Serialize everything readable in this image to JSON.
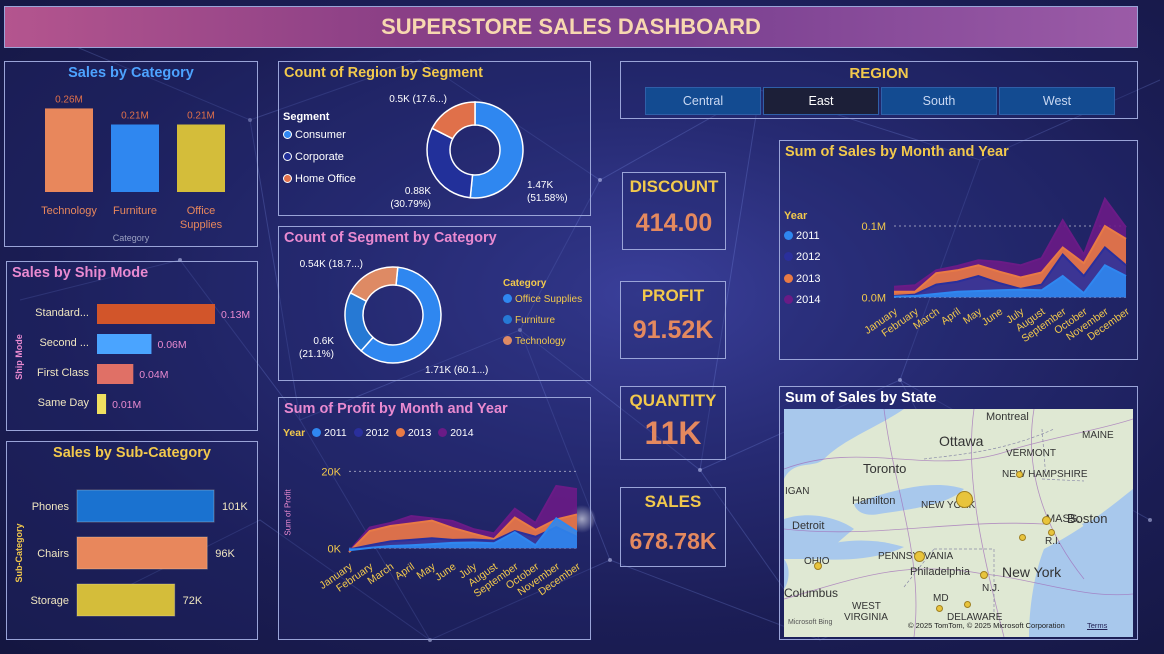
{
  "header": {
    "title": "SUPERSTORE SALES DASHBOARD"
  },
  "colors": {
    "y2011": "#2f87f0",
    "y2012": "#2a2f9c",
    "y2013": "#e87a45",
    "y2014": "#6a1b86",
    "consumer": "#2f87f0",
    "corporate": "#22309a",
    "home_office": "#e0704a",
    "office_supplies": "#2f87f0",
    "furniture": "#2679d4",
    "technology": "#de8a64"
  },
  "sales_by_category": {
    "title": "Sales by Category",
    "axis_title": "Category",
    "chart_data": {
      "type": "bar",
      "categories": [
        "Technology",
        "Furniture",
        "Office Supplies"
      ],
      "values": [
        0.26,
        0.21,
        0.21
      ],
      "labels": [
        "0.26M",
        "0.21M",
        "0.21M"
      ],
      "colors": [
        "#e8875c",
        "#2f87f0",
        "#d4bd3a"
      ],
      "ylim": [
        0,
        0.28
      ]
    }
  },
  "region_by_segment": {
    "title": "Count of Region by Segment",
    "legend_title": "Segment",
    "legend": [
      "Consumer",
      "Corporate",
      "Home Office"
    ],
    "chart_data": {
      "type": "pie",
      "labels": [
        "Consumer",
        "Corporate",
        "Home Office"
      ],
      "values": [
        1.47,
        0.88,
        0.5
      ],
      "slice_labels": [
        "1.47K\n(51.58%)",
        "0.88K\n(30.79%)",
        "0.5K (17.6...)"
      ]
    }
  },
  "segment_by_category": {
    "title": "Count of Segment by Category",
    "legend_title": "Category",
    "legend": [
      "Office Supplies",
      "Furniture",
      "Technology"
    ],
    "chart_data": {
      "type": "pie",
      "labels": [
        "Office Supplies",
        "Furniture",
        "Technology"
      ],
      "values": [
        1.71,
        0.6,
        0.54
      ],
      "slice_labels": [
        "1.71K (60.1...)",
        "0.6K\n(21.1%)",
        "0.54K (18.7...)"
      ]
    }
  },
  "ship_mode": {
    "title": "Sales by Ship Mode",
    "axis_title": "Ship Mode",
    "chart_data": {
      "type": "bar",
      "orientation": "horizontal",
      "categories": [
        "Standard...",
        "Second ...",
        "First Class",
        "Same Day"
      ],
      "values": [
        0.13,
        0.06,
        0.04,
        0.01
      ],
      "labels": [
        "0.13M",
        "0.06M",
        "0.04M",
        "0.01M"
      ],
      "colors": [
        "#d2552a",
        "#4aa4ff",
        "#e07066",
        "#f0e060"
      ],
      "xlim": [
        0,
        0.13
      ]
    }
  },
  "sub_category": {
    "title": "Sales by Sub-Category",
    "axis_title": "Sub-Category",
    "chart_data": {
      "type": "bar",
      "orientation": "horizontal",
      "categories": [
        "Phones",
        "Chairs",
        "Storage"
      ],
      "values": [
        101,
        96,
        72
      ],
      "labels": [
        "101K",
        "96K",
        "72K"
      ],
      "colors": [
        "#1a72d0",
        "#e8875c",
        "#d4bd3a"
      ],
      "xlim": [
        0,
        101
      ]
    }
  },
  "profit_chart": {
    "title": "Sum of Profit by Month and Year",
    "legend_title": "Year",
    "ylabel": "Sum of Profit",
    "ticks": [
      "20K",
      "0K"
    ],
    "chart_data": {
      "type": "area",
      "x": [
        "January",
        "February",
        "March",
        "April",
        "May",
        "June",
        "July",
        "August",
        "September",
        "October",
        "November",
        "December"
      ],
      "ylim": [
        -2,
        24
      ],
      "series": [
        {
          "name": "2011",
          "values": [
            -0.5,
            0.1,
            0.6,
            0.8,
            1.1,
            1.4,
            1.5,
            1.3,
            4.2,
            0.8,
            7.8,
            4.3
          ]
        },
        {
          "name": "2012",
          "values": [
            -0.3,
            0.8,
            1.8,
            2.2,
            2.6,
            2.2,
            2.3,
            2.0,
            4.5,
            3.0,
            5.5,
            3.0
          ]
        },
        {
          "name": "2013",
          "values": [
            -1.0,
            4.5,
            5.8,
            6.5,
            7.2,
            5.3,
            3.8,
            2.4,
            8.0,
            4.8,
            7.5,
            8.8
          ]
        },
        {
          "name": "2014",
          "values": [
            -0.8,
            5.4,
            6.6,
            8.4,
            7.8,
            7.1,
            5.0,
            3.9,
            10.3,
            6.6,
            16.2,
            15.4
          ]
        }
      ]
    }
  },
  "region": {
    "title": "REGION",
    "options": [
      "Central",
      "East",
      "South",
      "West"
    ],
    "selected": "East"
  },
  "kpis": {
    "discount_label": "DISCOUNT",
    "discount_value": "414.00",
    "profit_label": "PROFIT",
    "profit_value": "91.52K",
    "quantity_label": "QUANTITY",
    "quantity_value": "11K",
    "sales_label": "SALES",
    "sales_value": "678.78K"
  },
  "sales_chart": {
    "title": "Sum of Sales by Month and Year",
    "legend_title": "Year",
    "ticks": [
      "0.1M",
      "0.0M"
    ],
    "chart_data": {
      "type": "area",
      "x": [
        "January",
        "February",
        "March",
        "April",
        "May",
        "June",
        "July",
        "August",
        "September",
        "October",
        "November",
        "December"
      ],
      "ylim": [
        -0.005,
        0.135
      ],
      "series": [
        {
          "name": "2011",
          "values": [
            0.001,
            0.002,
            0.005,
            0.008,
            0.009,
            0.01,
            0.011,
            0.01,
            0.03,
            0.006,
            0.045,
            0.03
          ]
        },
        {
          "name": "2012",
          "values": [
            0.002,
            0.004,
            0.018,
            0.022,
            0.03,
            0.02,
            0.012,
            0.018,
            0.06,
            0.03,
            0.07,
            0.045
          ]
        },
        {
          "name": "2013",
          "values": [
            0.008,
            0.008,
            0.034,
            0.038,
            0.045,
            0.036,
            0.028,
            0.035,
            0.07,
            0.048,
            0.1,
            0.082
          ]
        },
        {
          "name": "2014",
          "values": [
            0.015,
            0.017,
            0.038,
            0.044,
            0.052,
            0.05,
            0.045,
            0.055,
            0.108,
            0.06,
            0.138,
            0.098
          ]
        }
      ]
    }
  },
  "map": {
    "title": "Sum of Sales by State",
    "labels": [
      "Montreal",
      "Ottawa",
      "MAINE",
      "Toronto",
      "VERMONT",
      "NEW HAMPSHIRE",
      "IGAN",
      "Hamilton",
      "NEW YORK",
      "MASS.",
      "Boston",
      "Detroit",
      "R.I.",
      "OHIO",
      "PENNSYLVANIA",
      "Philadelphia",
      "New York",
      "Columbus",
      "N.J.",
      "MD",
      "WEST",
      "VIRGINIA",
      "DELAWARE"
    ],
    "attribution": "© 2025 TomTom, © 2025 Microsoft Corporation",
    "terms": "Terms",
    "logo": "Microsoft Bing"
  }
}
